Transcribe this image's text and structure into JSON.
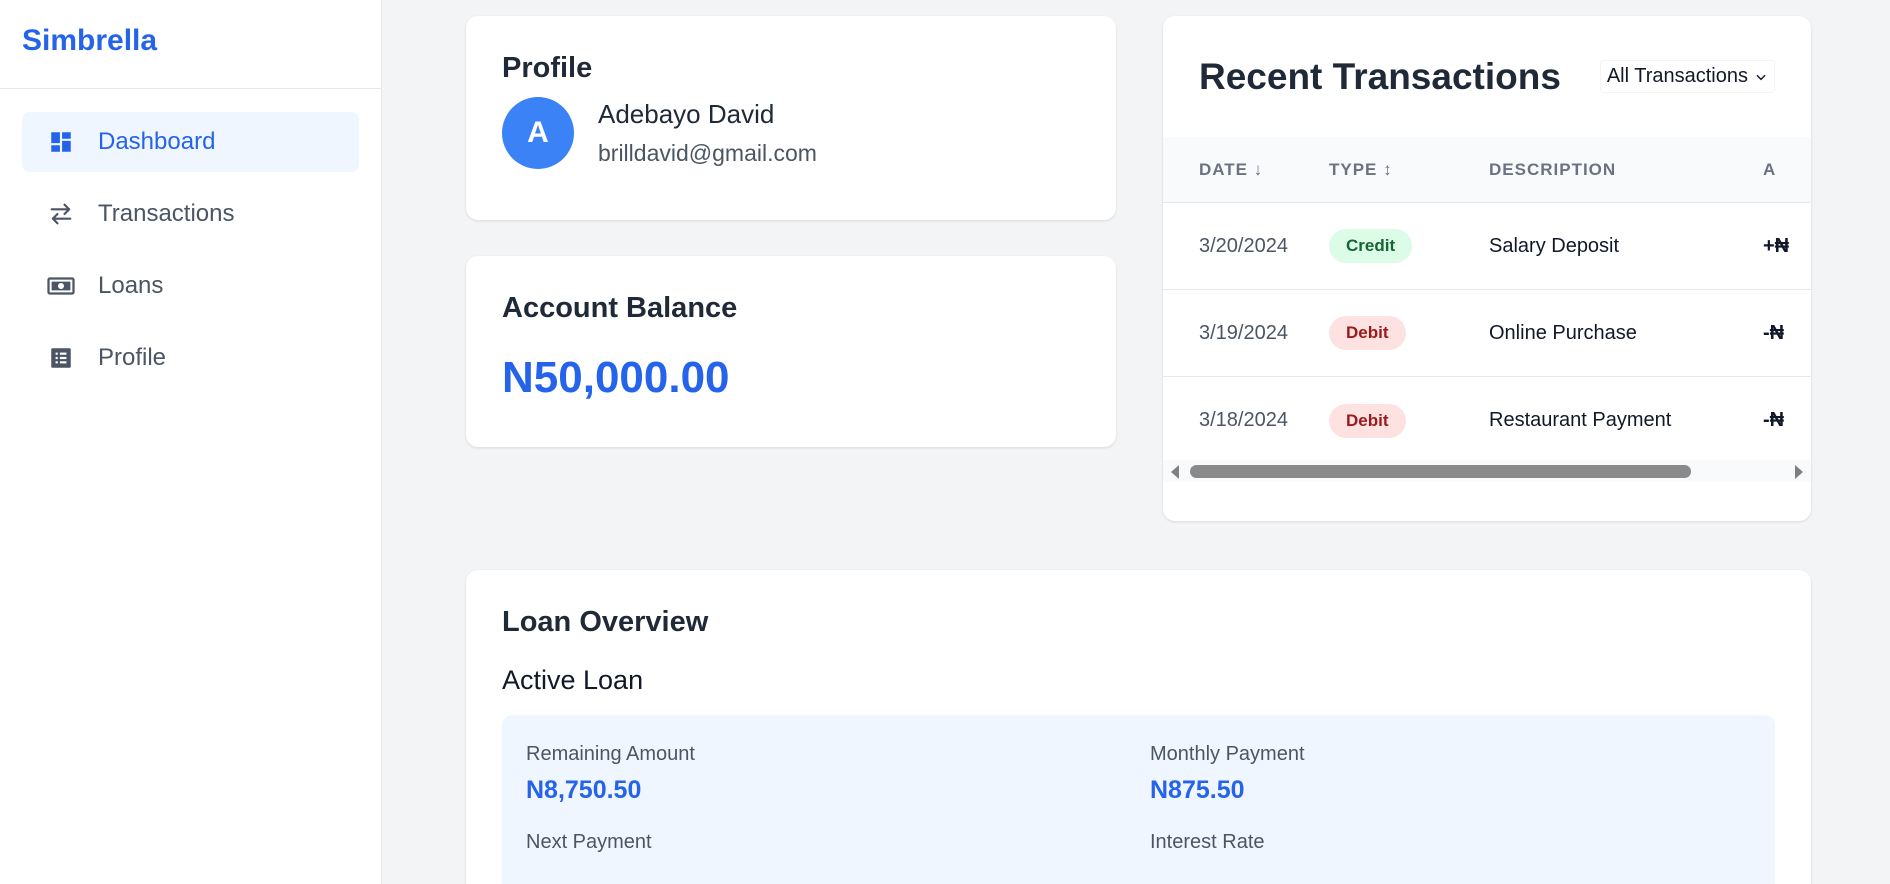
{
  "brand": "Simbrella",
  "sidebar": {
    "items": [
      {
        "label": "Dashboard",
        "icon": "dashboard-icon"
      },
      {
        "label": "Transactions",
        "icon": "swap-arrows-icon"
      },
      {
        "label": "Loans",
        "icon": "banknote-icon"
      },
      {
        "label": "Profile",
        "icon": "list-icon"
      }
    ],
    "active": "Dashboard"
  },
  "profile": {
    "title": "Profile",
    "initial": "A",
    "name": "Adebayo David",
    "email": "brilldavid@gmail.com"
  },
  "balance": {
    "title": "Account Balance",
    "amount": "N50,000.00"
  },
  "transactions": {
    "title": "Recent Transactions",
    "filter": "All Transactions",
    "columns": {
      "date": "DATE ↓",
      "type": "TYPE ↕",
      "description": "DESCRIPTION",
      "amount": "A"
    },
    "rows": [
      {
        "date": "3/20/2024",
        "type": "Credit",
        "description": "Salary Deposit",
        "amount": "+₦"
      },
      {
        "date": "3/19/2024",
        "type": "Debit",
        "description": "Online Purchase",
        "amount": "-₦"
      },
      {
        "date": "3/18/2024",
        "type": "Debit",
        "description": "Restaurant Payment",
        "amount": "-₦"
      }
    ]
  },
  "loan": {
    "title": "Loan Overview",
    "subtitle": "Active Loan",
    "fields": {
      "remaining_label": "Remaining Amount",
      "remaining_value": "N8,750.50",
      "monthly_label": "Monthly Payment",
      "monthly_value": "N875.50",
      "next_label": "Next Payment",
      "interest_label": "Interest Rate"
    }
  },
  "colors": {
    "accent": "#2563eb",
    "credit_bg": "#dcfce7",
    "debit_bg": "#fee2e2"
  }
}
